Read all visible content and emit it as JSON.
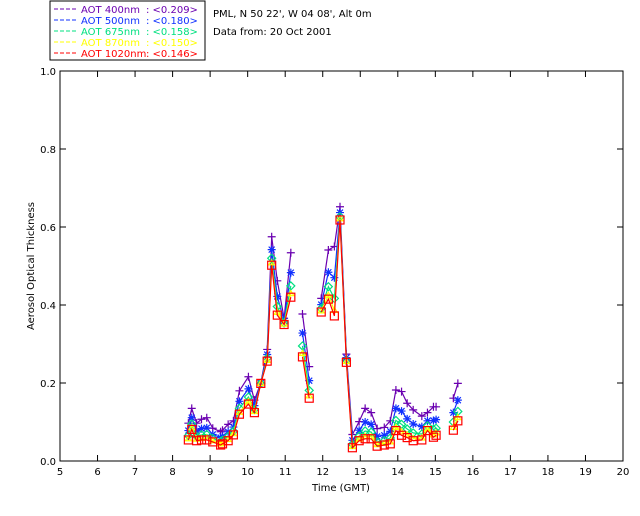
{
  "header": {
    "site": "PML, N 50 22', W 04 08', Alt 0m",
    "date": "Data from: 20 Oct 2001"
  },
  "chart_data": {
    "type": "line",
    "title": "",
    "xlabel": "Time (GMT)",
    "ylabel": "Aerosol Optical Thickness",
    "xlim": [
      5,
      20
    ],
    "ylim": [
      0,
      1.0
    ],
    "xticks": [
      "5",
      "6",
      "7",
      "8",
      "9",
      "10",
      "11",
      "12",
      "13",
      "14",
      "15",
      "16",
      "17",
      "18",
      "19",
      "20"
    ],
    "yticks": [
      "0.0",
      "0.2",
      "0.4",
      "0.6",
      "0.8",
      "1.0"
    ],
    "grid": false,
    "legend_placement": "top-left, outside plot",
    "x": [
      8.42,
      8.51,
      8.64,
      8.77,
      8.91,
      9.07,
      9.28,
      9.33,
      9.48,
      9.62,
      9.78,
      10.02,
      10.18,
      10.35,
      10.52,
      10.64,
      10.79,
      10.97,
      11.15,
      null,
      11.46,
      11.64,
      null,
      11.96,
      12.15,
      12.31,
      12.46,
      12.63,
      12.79,
      12.97,
      13.13,
      13.29,
      13.45,
      13.64,
      13.8,
      13.95,
      14.1,
      14.25,
      14.41,
      14.64,
      14.79,
      14.95,
      15.02,
      null,
      15.48,
      15.6
    ],
    "series": [
      {
        "name": "AOT  400nm : <0.209>",
        "legend_label": "AOT  400nm",
        "legend_mean": ": <0.209>",
        "color": "#6a00b0",
        "marker": "plus",
        "values": [
          0.097,
          0.135,
          0.097,
          0.107,
          0.111,
          0.084,
          0.075,
          0.079,
          0.094,
          0.103,
          0.18,
          0.216,
          0.156,
          0.2,
          0.286,
          0.575,
          0.462,
          0.366,
          0.534,
          null,
          0.377,
          0.242,
          null,
          0.417,
          0.541,
          0.55,
          0.652,
          0.274,
          0.068,
          0.101,
          0.135,
          0.124,
          0.083,
          0.086,
          0.103,
          0.182,
          0.178,
          0.148,
          0.131,
          0.115,
          0.124,
          0.139,
          0.139,
          null,
          0.161,
          0.199
        ]
      },
      {
        "name": "AOT  500nm : <0.180>",
        "legend_label": "AOT  500nm",
        "legend_mean": ": <0.180>",
        "color": "#1030ff",
        "marker": "asterisk",
        "values": [
          0.078,
          0.111,
          0.077,
          0.083,
          0.085,
          0.068,
          0.06,
          0.063,
          0.075,
          0.087,
          0.153,
          0.185,
          0.142,
          0.2,
          0.273,
          0.542,
          0.422,
          0.359,
          0.483,
          null,
          0.328,
          0.206,
          null,
          0.401,
          0.484,
          0.47,
          0.637,
          0.265,
          0.053,
          0.079,
          0.1,
          0.094,
          0.063,
          0.066,
          0.076,
          0.135,
          0.128,
          0.108,
          0.095,
          0.088,
          0.103,
          0.104,
          0.106,
          null,
          0.124,
          0.156
        ]
      },
      {
        "name": "AOT  675nm : <0.158>",
        "legend_label": "AOT  675nm",
        "legend_mean": ": <0.158>",
        "color": "#00e080",
        "marker": "diamond",
        "values": [
          0.065,
          0.095,
          0.063,
          0.067,
          0.068,
          0.058,
          0.05,
          0.053,
          0.063,
          0.076,
          0.135,
          0.164,
          0.132,
          0.199,
          0.264,
          0.52,
          0.396,
          0.354,
          0.449,
          null,
          0.295,
          0.181,
          null,
          0.391,
          0.447,
          0.417,
          0.626,
          0.258,
          0.043,
          0.064,
          0.077,
          0.074,
          0.049,
          0.052,
          0.059,
          0.104,
          0.094,
          0.082,
          0.072,
          0.069,
          0.09,
          0.081,
          0.084,
          null,
          0.1,
          0.127
        ]
      },
      {
        "name": "AOT  870nm : <0.150>",
        "legend_label": "AOT  870nm",
        "legend_mean": ": <0.150>",
        "color": "#ffff00",
        "marker": "triangle",
        "values": [
          0.057,
          0.085,
          0.056,
          0.058,
          0.059,
          0.052,
          0.044,
          0.047,
          0.055,
          0.07,
          0.125,
          0.152,
          0.127,
          0.199,
          0.258,
          0.508,
          0.381,
          0.351,
          0.429,
          null,
          0.276,
          0.167,
          null,
          0.385,
          0.425,
          0.386,
          0.621,
          0.255,
          0.037,
          0.056,
          0.063,
          0.062,
          0.042,
          0.045,
          0.049,
          0.086,
          0.075,
          0.067,
          0.058,
          0.059,
          0.082,
          0.067,
          0.072,
          null,
          0.086,
          0.111
        ]
      },
      {
        "name": "AOT 1020nm : <0.146>",
        "legend_label": "AOT 1020nm",
        "legend_mean": ": <0.146>",
        "color": "#ff0000",
        "marker": "square",
        "values": [
          0.054,
          0.081,
          0.052,
          0.054,
          0.054,
          0.049,
          0.041,
          0.044,
          0.052,
          0.067,
          0.12,
          0.146,
          0.124,
          0.199,
          0.256,
          0.502,
          0.374,
          0.35,
          0.42,
          null,
          0.267,
          0.161,
          null,
          0.382,
          0.415,
          0.372,
          0.618,
          0.253,
          0.034,
          0.052,
          0.057,
          0.057,
          0.038,
          0.041,
          0.044,
          0.078,
          0.066,
          0.06,
          0.052,
          0.054,
          0.078,
          0.061,
          0.066,
          null,
          0.079,
          0.103
        ]
      }
    ]
  }
}
